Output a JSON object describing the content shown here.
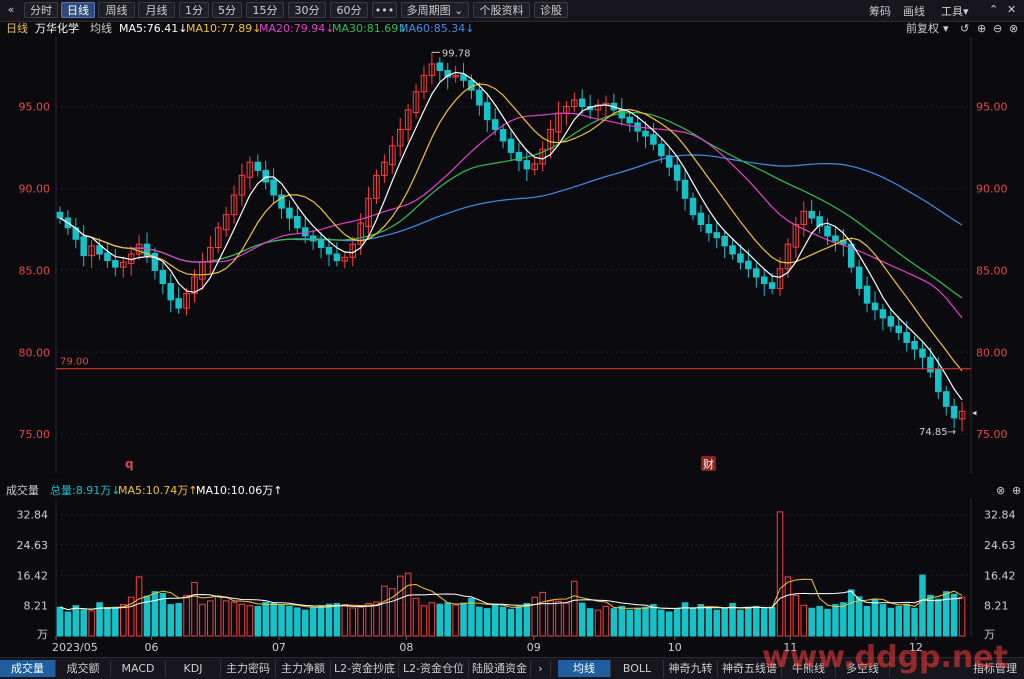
{
  "toolbar": {
    "back": "«",
    "tabs": [
      "分时",
      "日线",
      "周线",
      "月线",
      "1分",
      "5分",
      "15分",
      "30分",
      "60分",
      "•••"
    ],
    "active_tab": "日线",
    "multi_period": "多周期图 ⌄",
    "stock_info": "个股资料",
    "diagnose": "诊股",
    "right": {
      "chips": "筹码",
      "draw": "画线",
      "tools": "工具▾"
    }
  },
  "info": {
    "period": "日线",
    "stock_name": "万华化学",
    "ma_label": "均线",
    "ma5": "MA5:76.41↓",
    "ma10": "MA10:77.89↓",
    "ma20": "MA20:79.94↓",
    "ma30": "MA30:81.69↓",
    "ma60": "MA60:85.34↓",
    "adjust": "前复权"
  },
  "volume_info": {
    "title": "成交量",
    "total": "总量:8.91万↓",
    "ma5": "MA5:10.74万↑",
    "ma10": "MA10:10.06万↑"
  },
  "colors": {
    "up": "#ff3b3b",
    "down": "#14c2c8",
    "ma5": "#ffffff",
    "ma10": "#f2c230",
    "ma20": "#e040c8",
    "ma30": "#2fbf4f",
    "ma60": "#3f8fe8",
    "hline": "#d83030"
  },
  "chart_data": {
    "type": "candlestick",
    "y_ticks": [
      "95.00",
      "90.00",
      "85.00",
      "80.00",
      "75.00"
    ],
    "x_ticks": [
      "2023/05",
      "06",
      "07",
      "08",
      "09",
      "10",
      "11",
      "12"
    ],
    "ylim": [
      73.0,
      99.0
    ],
    "hline": {
      "value": 79.0,
      "label": "79.00"
    },
    "high_label": "99.78",
    "low_label": "74.85→",
    "markers": {
      "q": "q",
      "cai": "财"
    },
    "closes": [
      88.2,
      87.6,
      86.9,
      85.9,
      86.5,
      86.0,
      85.6,
      85.2,
      85.5,
      86.0,
      86.6,
      85.9,
      85.0,
      84.2,
      83.2,
      82.7,
      83.6,
      84.6,
      85.5,
      86.4,
      87.6,
      88.4,
      89.6,
      90.8,
      91.6,
      91.1,
      90.4,
      89.6,
      88.8,
      88.2,
      87.6,
      87.1,
      86.8,
      86.4,
      86.0,
      85.6,
      85.8,
      86.6,
      87.9,
      89.4,
      90.8,
      91.6,
      92.6,
      93.6,
      94.8,
      95.9,
      96.9,
      97.6,
      97.2,
      96.8,
      96.9,
      96.6,
      96.0,
      95.1,
      94.2,
      93.6,
      92.9,
      92.2,
      91.7,
      91.2,
      91.5,
      92.4,
      93.6,
      94.6,
      95.0,
      95.4,
      95.0,
      94.8,
      95.1,
      95.2,
      94.8,
      94.3,
      94.0,
      93.5,
      93.2,
      92.7,
      92.0,
      91.3,
      90.5,
      89.4,
      88.4,
      87.8,
      87.3,
      87.0,
      86.5,
      86.0,
      85.5,
      85.1,
      84.6,
      84.2,
      83.9,
      85.1,
      86.6,
      87.8,
      88.6,
      88.2,
      87.7,
      87.1,
      86.8,
      86.6,
      85.2,
      83.9,
      83.0,
      82.6,
      82.1,
      81.6,
      81.2,
      80.6,
      80.2,
      79.7,
      78.8,
      77.6,
      76.7,
      76.0,
      76.4
    ],
    "volumes": [
      7.8,
      6.5,
      8.2,
      7.0,
      6.8,
      9.0,
      7.6,
      7.8,
      8.5,
      10.5,
      16.0,
      10.8,
      12.0,
      11.5,
      8.5,
      8.8,
      11.0,
      14.5,
      8.6,
      9.5,
      10.7,
      9.5,
      9.1,
      8.6,
      8.2,
      8.0,
      9.1,
      8.8,
      8.4,
      8.0,
      7.6,
      7.0,
      7.8,
      8.2,
      8.6,
      8.8,
      8.5,
      7.6,
      7.8,
      8.8,
      9.2,
      13.5,
      12.8,
      16.2,
      17.0,
      10.2,
      8.2,
      9.0,
      8.6,
      9.0,
      8.4,
      8.9,
      10.2,
      7.8,
      7.4,
      8.6,
      7.8,
      7.2,
      8.0,
      8.8,
      10.5,
      11.8,
      9.5,
      9.4,
      8.9,
      14.8,
      8.9,
      7.4,
      7.0,
      8.0,
      7.4,
      8.0,
      7.0,
      7.4,
      7.8,
      8.5,
      7.0,
      6.5,
      7.4,
      9.0,
      7.4,
      8.5,
      7.5,
      7.0,
      7.5,
      8.8,
      7.0,
      7.5,
      8.0,
      7.4,
      7.8,
      33.6,
      16.0,
      11.0,
      8.3,
      7.5,
      8.0,
      7.2,
      8.5,
      9.0,
      12.5,
      10.6,
      8.0,
      10.0,
      8.5,
      7.5,
      8.0,
      8.6,
      7.5,
      16.5,
      11.0,
      10.0,
      12.0,
      11.3,
      10.5
    ],
    "volume_y_ticks": [
      "32.84",
      "24.63",
      "16.42",
      "8.21",
      "万"
    ],
    "volume_ylim": [
      0,
      36
    ]
  },
  "bottom_tabs": {
    "left": [
      "成交量",
      "成交额",
      "MACD",
      "KDJ",
      "主力密码",
      "主力净额",
      "L2-资金抄底",
      "L2-资金仓位",
      "陆股通资金"
    ],
    "right": [
      "均线",
      "BOLL",
      "神奇九转",
      "神奇五线谱",
      "牛熊线",
      "多空线"
    ],
    "manage": "指标管理",
    "watermark": "www.ddgp.net"
  }
}
